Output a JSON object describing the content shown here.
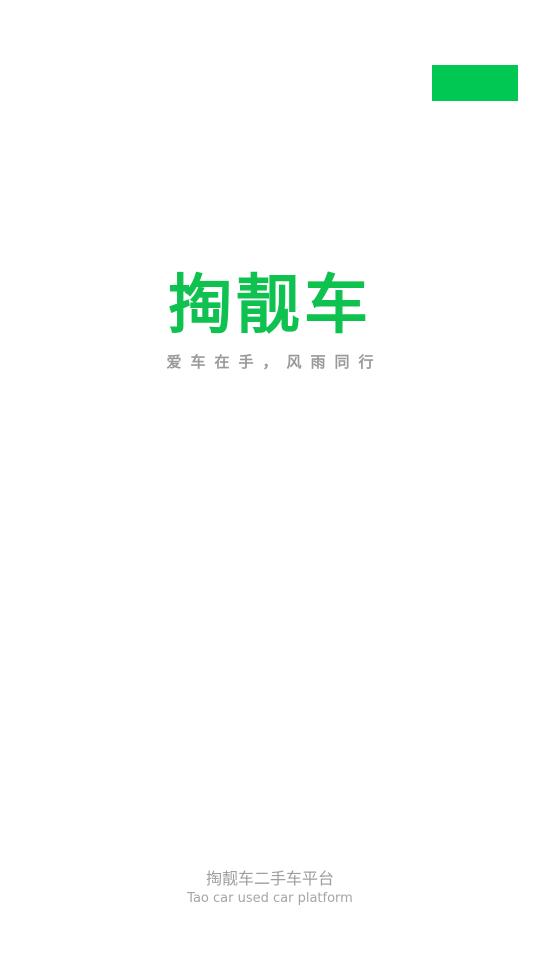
{
  "splash": {
    "skip_label": "",
    "brand_title": "掏靓车",
    "slogan": "爱车在手，风雨同行",
    "footer_cn": "掏靓车二手车平台",
    "footer_en": "Tao car used car platform"
  },
  "colors": {
    "brand_green": "#0fc14f",
    "button_green": "#00c853",
    "muted_text": "#9a9a9a",
    "background": "#ffffff"
  }
}
